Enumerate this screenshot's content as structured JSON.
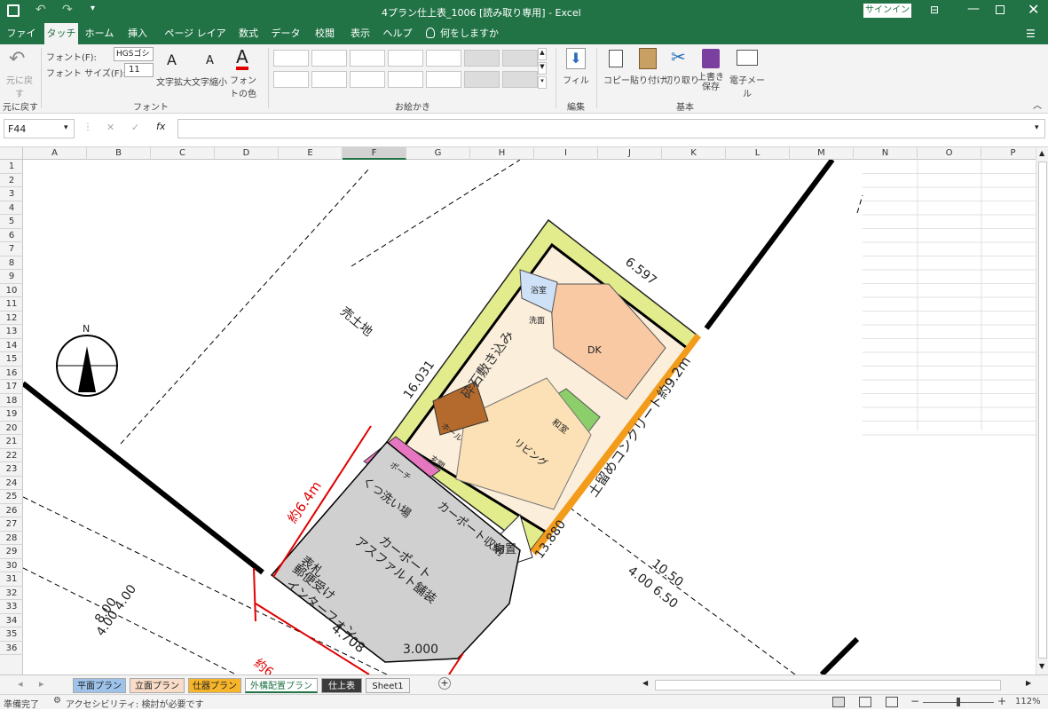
{
  "titlebar": {
    "title": "4プラン仕上表_1006 [読み取り専用] - Excel",
    "signin": "サインイン"
  },
  "tabs": [
    "ファイル",
    "タッチ",
    "ホーム",
    "挿入",
    "ページ レイアウト",
    "数式",
    "データ",
    "校閲",
    "表示",
    "ヘルプ",
    "何をしますか"
  ],
  "ribbon": {
    "undo_label": "元に戻す",
    "undo_group": "元に戻す",
    "font_name_label": "フォント(F):",
    "font_name_value": "HGSゴシックM",
    "font_size_label": "フォント サイズ(F):",
    "font_size_value": "11",
    "grow_label": "文字拡大",
    "shrink_label": "文字縮小",
    "font_color_label": "フォントの色",
    "font_group": "フォント",
    "draw_group": "お絵かき",
    "fill_label": "フィル",
    "edit_group": "編集",
    "copy_label": "コピー",
    "paste_label": "貼り付け",
    "cut_label": "切り取り",
    "save_label": "上書き保存",
    "email_label": "電子メール",
    "basic_group": "基本"
  },
  "formula": {
    "namebox": "F44",
    "content": ""
  },
  "columns": [
    "A",
    "B",
    "C",
    "D",
    "E",
    "F",
    "G",
    "H",
    "I",
    "J",
    "K",
    "L",
    "M",
    "N",
    "O",
    "P"
  ],
  "rows": [
    "1",
    "2",
    "3",
    "4",
    "5",
    "6",
    "7",
    "8",
    "9",
    "10",
    "11",
    "12",
    "13",
    "14",
    "15",
    "16",
    "17",
    "18",
    "19",
    "20",
    "21",
    "22",
    "23",
    "24",
    "25",
    "26",
    "27",
    "28",
    "29",
    "30",
    "31",
    "32",
    "33",
    "34",
    "35",
    "36"
  ],
  "drawing": {
    "sale_land": "売土地",
    "gravel": "砕石敷き込み",
    "retaining": "土留めコンクリート約9.2m",
    "dim_16031": "16.031",
    "dim_6597": "6.597",
    "dim_13880": "13.880",
    "dim_approx64": "約6.4m",
    "dim_4708": "4.708",
    "dim_3000": "3.000",
    "dim_800": "8.00",
    "dim_400_400": "4.00 4.00",
    "dim_1050": "10.50",
    "dim_400_650": "4.00 6.50",
    "approx6": "約6",
    "carport": "カーポート",
    "asphalt": "アスファルト舗装",
    "nameplate": "表札",
    "mailbox": "郵便受け",
    "intercom": "インターフォン",
    "shoe_wash": "くつ洗い場",
    "carport_storage": "カーポート収納",
    "storage": "物置",
    "living": "リビング",
    "dk": "DK",
    "washitsu": "和室",
    "hall": "ホール",
    "genkan": "玄関",
    "porch": "ポーチ",
    "bath": "浴室",
    "washroom": "洗面",
    "north": "N"
  },
  "sheets": [
    {
      "label": "平面プラン",
      "color": "#9ec3ea"
    },
    {
      "label": "立面プラン",
      "color": "#f9dcc7"
    },
    {
      "label": "仕器プラン",
      "color": "#f7b52a"
    },
    {
      "label": "外構配置プラン",
      "color": "#ffffff"
    },
    {
      "label": "仕上表",
      "color": "#3b3b3b"
    },
    {
      "label": "Sheet1",
      "color": "#f3f3f3"
    }
  ],
  "status": {
    "ready": "準備完了",
    "accessibility": "アクセシビリティ: 検討が必要です",
    "zoom": "112%"
  }
}
